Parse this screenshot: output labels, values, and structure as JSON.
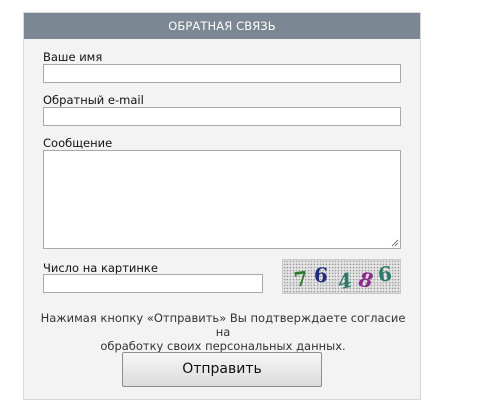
{
  "form": {
    "title": "ОБРАТНАЯ СВЯЗЬ",
    "name_label": "Ваше имя",
    "name_value": "",
    "email_label": "Обратный e-mail",
    "email_value": "",
    "message_label": "Сообщение",
    "message_value": "",
    "captcha_label": "Число на картинке",
    "captcha_value": "",
    "captcha_digits": [
      "7",
      "6",
      "4",
      "8",
      "6"
    ],
    "consent_line1": "Нажимая кнопку «Отправить» Вы подтверждаете согласие на",
    "consent_line2": "обработку своих персональных данных.",
    "submit_label": "Отправить"
  },
  "colors": {
    "header_bg": "#7b8792",
    "panel_bg": "#f3f3f3",
    "captcha_digit_colors": [
      "#2f7a2a",
      "#1f2a7a",
      "#2f7a6a",
      "#8a2a8a",
      "#2a7a6a"
    ]
  }
}
